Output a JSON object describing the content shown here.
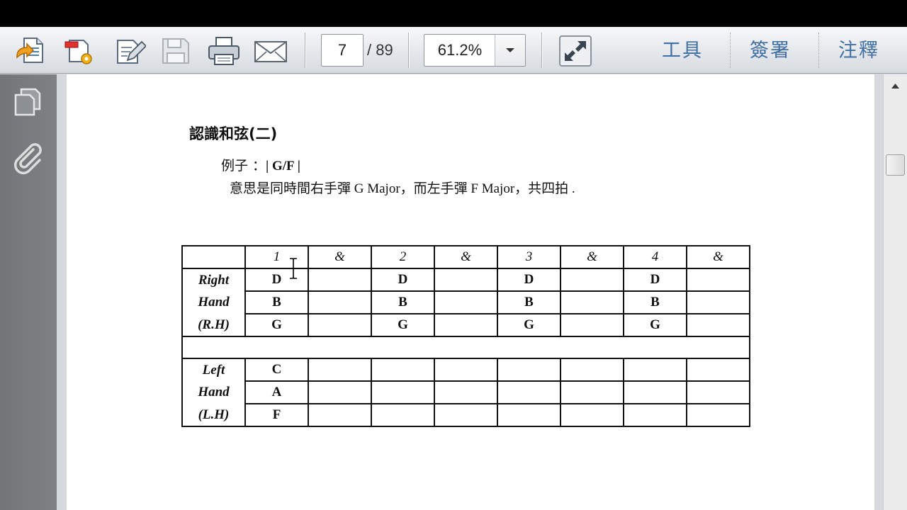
{
  "toolbar": {
    "page_current": "7",
    "page_total": "/ 89",
    "zoom": "61.2%",
    "commands": [
      "工具",
      "簽署",
      "注釋"
    ],
    "icons": [
      "create-pdf-icon",
      "convert-icon",
      "edit-icon",
      "save-icon",
      "print-icon",
      "email-icon",
      "fit-window-icon",
      "dropdown-arrow-icon"
    ]
  },
  "left_panel": {
    "icons": [
      "pages-icon",
      "attachments-icon"
    ]
  },
  "document": {
    "title": "認識和弦(二)",
    "example_label": "例子 ：",
    "example_value": "| G/F |",
    "description": "意思是同時間右手彈 G Major，而左手彈 F Major，共四拍 ."
  },
  "table": {
    "header": [
      "",
      "1",
      "&",
      "2",
      "&",
      "3",
      "&",
      "4",
      "&"
    ],
    "right_hand_labels": [
      "Right",
      "Hand",
      "(R.H)"
    ],
    "right_hand_rows": [
      [
        "D",
        "",
        "D",
        "",
        "D",
        "",
        "D",
        ""
      ],
      [
        "B",
        "",
        "B",
        "",
        "B",
        "",
        "B",
        ""
      ],
      [
        "G",
        "",
        "G",
        "",
        "G",
        "",
        "G",
        ""
      ]
    ],
    "left_hand_labels": [
      "Left",
      "Hand",
      "(L.H)"
    ],
    "left_hand_rows": [
      [
        "C",
        "",
        "",
        "",
        "",
        "",
        "",
        ""
      ],
      [
        "A",
        "",
        "",
        "",
        "",
        "",
        "",
        ""
      ],
      [
        "F",
        "",
        "",
        "",
        "",
        "",
        "",
        ""
      ]
    ]
  }
}
